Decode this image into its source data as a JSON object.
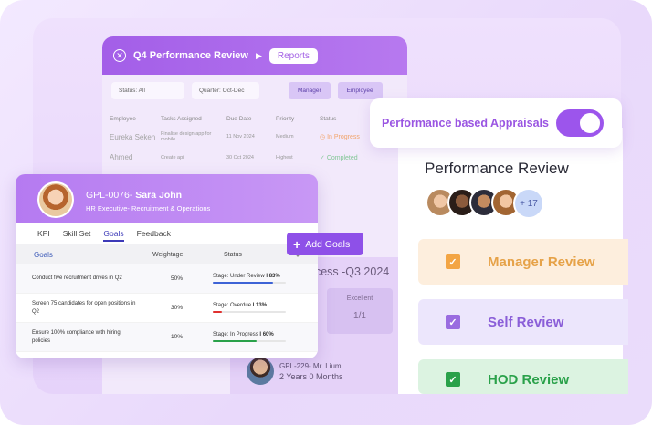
{
  "reports": {
    "title": "Q4 Performance Review",
    "tab": "Reports",
    "filter_status": "Status: All",
    "filter_quarter": "Quarter: Oct-Dec",
    "btn_manager": "Manager",
    "btn_employee": "Employee",
    "columns": [
      "Employee",
      "Tasks Assigned",
      "Due Date",
      "Priority",
      "Status"
    ],
    "rows": [
      {
        "employee": "Eureka Seken",
        "task": "Finalise design app for mobile",
        "due": "11 Nov 2024",
        "priority": "Medium",
        "status": "In Progress"
      },
      {
        "employee": "Ahmed",
        "task": "Create api",
        "due": "30 Oct 2024",
        "priority": "Highest",
        "status": "Completed"
      }
    ]
  },
  "process": {
    "title": "ocess -Q3 2024",
    "excellent_label": "Excellent",
    "excellent_value": "1/1",
    "manager_id": "GPL-229- Mr. Lium",
    "manager_tenure": "2 Years 0 Months"
  },
  "toggle": {
    "label": "Performance based Appraisals",
    "on": true
  },
  "review": {
    "title": "Performance Review",
    "extra_count": "+ 17",
    "items": [
      {
        "label": "Manager Review",
        "checked": true,
        "color": "#e6a248"
      },
      {
        "label": "Self Review",
        "checked": true,
        "color": "#8a5ed8"
      },
      {
        "label": "HOD Review",
        "checked": true,
        "color": "#2aa14a"
      }
    ]
  },
  "employee": {
    "id": "GPL-0076-",
    "name": "Sara John",
    "role": "HR Executive- Recruitment & Operations",
    "tabs": [
      "KPI",
      "Skill Set",
      "Goals",
      "Feedback"
    ],
    "active_tab": "Goals",
    "table_headers": {
      "goals": "Goals",
      "weightage": "Weightage",
      "status": "Status"
    },
    "goals": [
      {
        "text": "Conduct five recruitment drives in Q2",
        "weightage": "50%",
        "status": "Stage: Under Review",
        "pct": "83%",
        "progress": 0.83,
        "color": "#3d63d6"
      },
      {
        "text": "Screen 75 candidates for open positions in Q2",
        "weightage": "30%",
        "status": "Stage: Overdue",
        "pct": "13%",
        "progress": 0.13,
        "color": "#e0312f"
      },
      {
        "text": "Ensure 100% compliance with hiring policies",
        "weightage": "10%",
        "status": "Stage: In Progress",
        "pct": "60%",
        "progress": 0.6,
        "color": "#2aa14a"
      }
    ]
  },
  "add_goals": {
    "label": "Add Goals"
  }
}
